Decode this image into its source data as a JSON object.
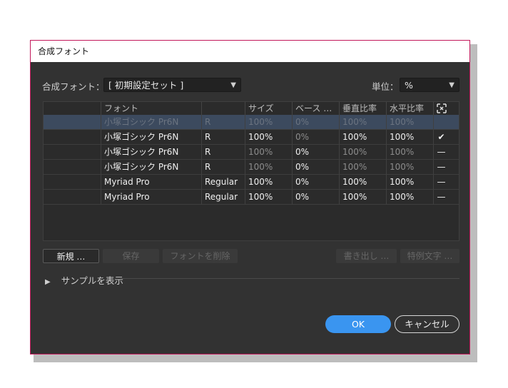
{
  "dialog": {
    "title": "合成フォント",
    "composite_font_label": "合成フォント：",
    "composite_font_value": "[ 初期設定セット ]",
    "unit_label": "単位：",
    "unit_value": "%"
  },
  "table": {
    "headers": [
      "フォント",
      "サイズ",
      "ベース …",
      "垂直比率",
      "水平比率"
    ],
    "rows": [
      {
        "font": "小塚ゴシック Pr6N",
        "style": "R",
        "size": "100%",
        "base": "0%",
        "vertical": "100%",
        "horizontal": "100%",
        "mark": "",
        "selected": true
      },
      {
        "font": "小塚ゴシック Pr6N",
        "style": "R",
        "size": "100%",
        "base": "0%",
        "vertical": "100%",
        "horizontal": "100%",
        "mark": "✔",
        "selected": false
      },
      {
        "font": "小塚ゴシック Pr6N",
        "style": "R",
        "size": "100%",
        "base": "0%",
        "vertical": "100%",
        "horizontal": "100%",
        "mark": "—",
        "selected": false
      },
      {
        "font": "小塚ゴシック Pr6N",
        "style": "R",
        "size": "100%",
        "base": "0%",
        "vertical": "100%",
        "horizontal": "100%",
        "mark": "—",
        "selected": false
      },
      {
        "font": "Myriad Pro",
        "style": "Regular",
        "size": "100%",
        "base": "0%",
        "vertical": "100%",
        "horizontal": "100%",
        "mark": "—",
        "selected": false
      },
      {
        "font": "Myriad Pro",
        "style": "Regular",
        "size": "100%",
        "base": "0%",
        "vertical": "100%",
        "horizontal": "100%",
        "mark": "—",
        "selected": false
      }
    ]
  },
  "buttons": {
    "new": "新規 …",
    "save": "保存",
    "delete_font": "フォントを削除",
    "export": "書き出し …",
    "exceptions": "特例文字 …",
    "ok": "OK",
    "cancel": "キャンセル"
  },
  "sample_toggle": "サンプルを表示",
  "colors": {
    "accent": "#3a95f0",
    "dialog_bg": "#323232",
    "border": "#c2185b"
  }
}
